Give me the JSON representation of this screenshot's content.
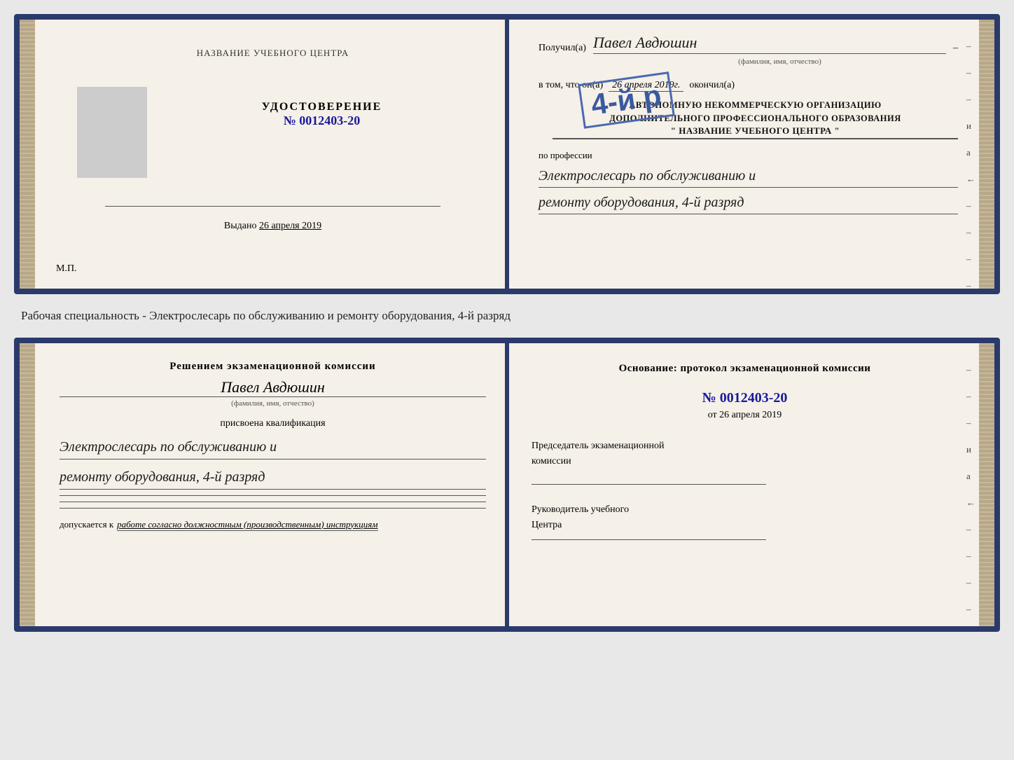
{
  "top_doc": {
    "left": {
      "title": "НАЗВАНИЕ УЧЕБНОГО ЦЕНТРА",
      "udostoverenie_label": "УДОСТОВЕРЕНИЕ",
      "number": "№ 0012403-20",
      "vydano_label": "Выдано",
      "vydano_date": "26 апреля 2019",
      "mp": "М.П."
    },
    "right": {
      "poluchil_label": "Получил(а)",
      "recipient_name": "Павел Авдюшин",
      "fio_subtitle": "(фамилия, имя, отчество)",
      "vtom_label": "в том, что он(а)",
      "vtom_date": "26 апреля 2019г.",
      "okonchil_label": "окончил(а)",
      "stamp_4y": "4-й р",
      "org_line1": "АВТОНОМНУЮ НЕКОММЕРЧЕСКУЮ ОРГАНИЗАЦИЮ",
      "org_line2": "ДОПОЛНИТЕЛЬНОГО ПРОФЕССИОНАЛЬНОГО ОБРАЗОВАНИЯ",
      "org_name": "\" НАЗВАНИЕ УЧЕБНОГО ЦЕНТРА \"",
      "po_professii": "по профессии",
      "profession1": "Электрослесарь по обслуживанию и",
      "profession2": "ремонту оборудования, 4-й разряд",
      "dashes": [
        "–",
        "–",
        "–",
        "и",
        "а",
        "←",
        "–",
        "–",
        "–",
        "–"
      ]
    }
  },
  "middle_text": "Рабочая специальность - Электрослесарь по обслуживанию и ремонту оборудования, 4-й разряд",
  "bottom_doc": {
    "left": {
      "resheniem": "Решением экзаменационной комиссии",
      "name": "Павел Авдюшин",
      "fio_sub": "(фамилия, имя, отчество)",
      "prisvoyena": "присвоена квалификация",
      "qualification1": "Электрослесарь по обслуживанию и",
      "qualification2": "ремонту оборудования, 4-й разряд",
      "dopuskaetsya_label": "допускается к",
      "dopuskaetsya_text": "работе согласно должностным (производственным) инструкциям"
    },
    "right": {
      "osnovanie": "Основание: протокол экзаменационной комиссии",
      "protocol_number": "№ 0012403-20",
      "ot_label": "от",
      "ot_date": "26 апреля 2019",
      "chairman_line1": "Председатель экзаменационной",
      "chairman_line2": "комиссии",
      "rukovoditel_line1": "Руководитель учебного",
      "rukovoditel_line2": "Центра",
      "dashes": [
        "–",
        "–",
        "–",
        "и",
        "а",
        "←",
        "–",
        "–",
        "–",
        "–"
      ]
    }
  }
}
